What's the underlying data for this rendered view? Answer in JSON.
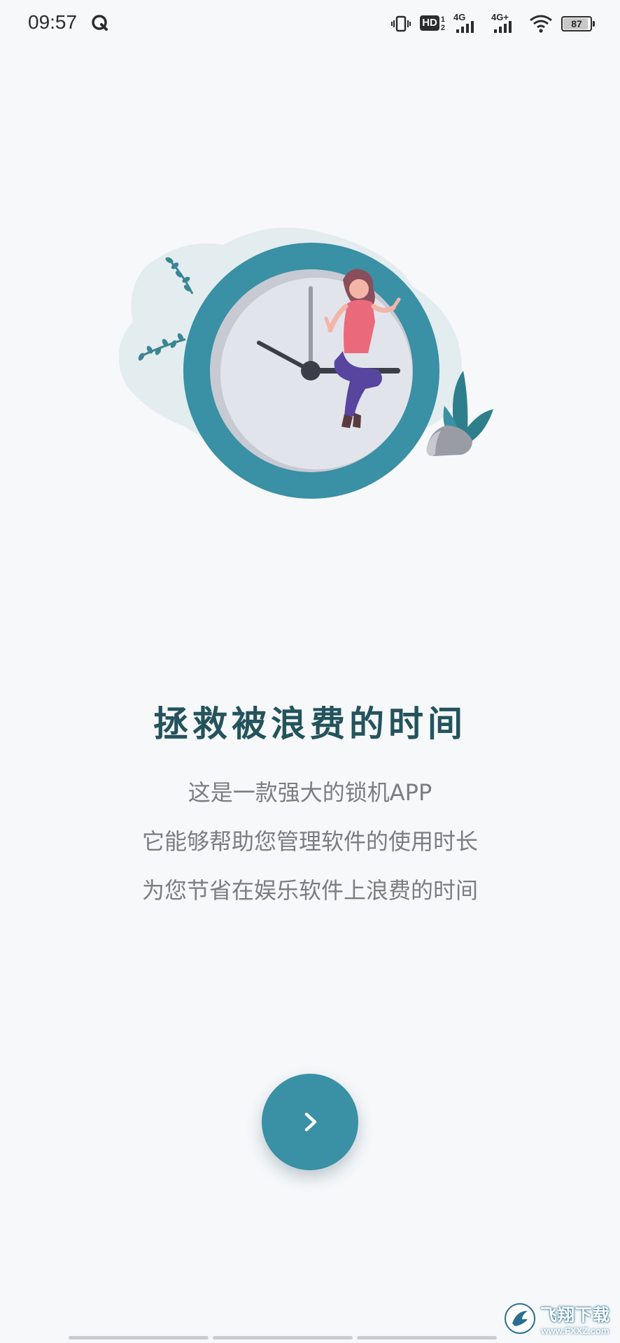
{
  "status_bar": {
    "time": "09:57",
    "hd_label": "HD",
    "hd_sim_top": "1",
    "hd_sim_bottom": "2",
    "signal1_label": "4G",
    "signal2_label": "4G+",
    "battery_percent": "87",
    "battery_level": 0.87
  },
  "onboarding": {
    "title": "拯救被浪费的时间",
    "description_lines": [
      "这是一款强大的锁机APP",
      "它能够帮助您管理软件的使用时长",
      "为您节省在娱乐软件上浪费的时间"
    ],
    "next_icon": "chevron-right-icon",
    "accent_color": "#3a90a4",
    "title_color": "#24535c"
  },
  "watermark": {
    "main": "飞翔下载",
    "sub": "www.FXXZ.com"
  }
}
